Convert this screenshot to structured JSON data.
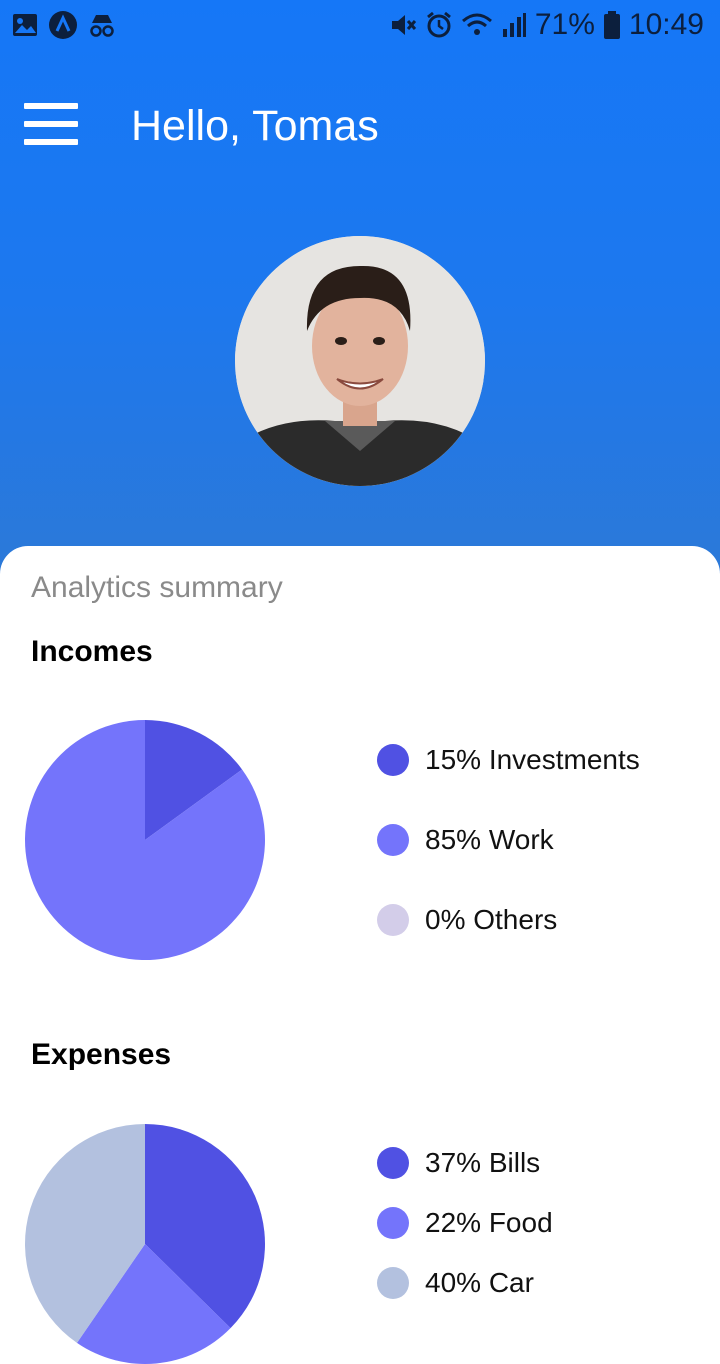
{
  "status_bar": {
    "battery": "71%",
    "time": "10:49",
    "left_icons": [
      "gallery-icon",
      "app-a-icon",
      "incognito-icon"
    ],
    "right_icons": [
      "mute-icon",
      "alarm-icon",
      "wifi-icon",
      "signal-icon",
      "battery-icon"
    ]
  },
  "header": {
    "greeting": "Hello, Tomas",
    "menu_icon": "hamburger-menu-icon"
  },
  "summary": {
    "title": "Analytics summary",
    "incomes": {
      "title": "Incomes",
      "legend": [
        {
          "label": "15% Investments",
          "color": "#5051e3"
        },
        {
          "label": "85% Work",
          "color": "#7474fb"
        },
        {
          "label": "0% Others",
          "color": "#d3cde9"
        }
      ]
    },
    "expenses": {
      "title": "Expenses",
      "legend": [
        {
          "label": "37% Bills",
          "color": "#5051e3"
        },
        {
          "label": "22% Food",
          "color": "#7474fb"
        },
        {
          "label": "40% Car",
          "color": "#b3c1df"
        }
      ]
    }
  },
  "chart_data": [
    {
      "type": "pie",
      "title": "Incomes",
      "categories": [
        "Investments",
        "Work",
        "Others"
      ],
      "values": [
        15,
        85,
        0
      ],
      "colors": [
        "#5051e3",
        "#7474fb",
        "#d3cde9"
      ]
    },
    {
      "type": "pie",
      "title": "Expenses",
      "categories": [
        "Bills",
        "Food",
        "Car"
      ],
      "values": [
        37,
        22,
        40
      ],
      "colors": [
        "#5051e3",
        "#7474fb",
        "#b3c1df"
      ]
    }
  ]
}
